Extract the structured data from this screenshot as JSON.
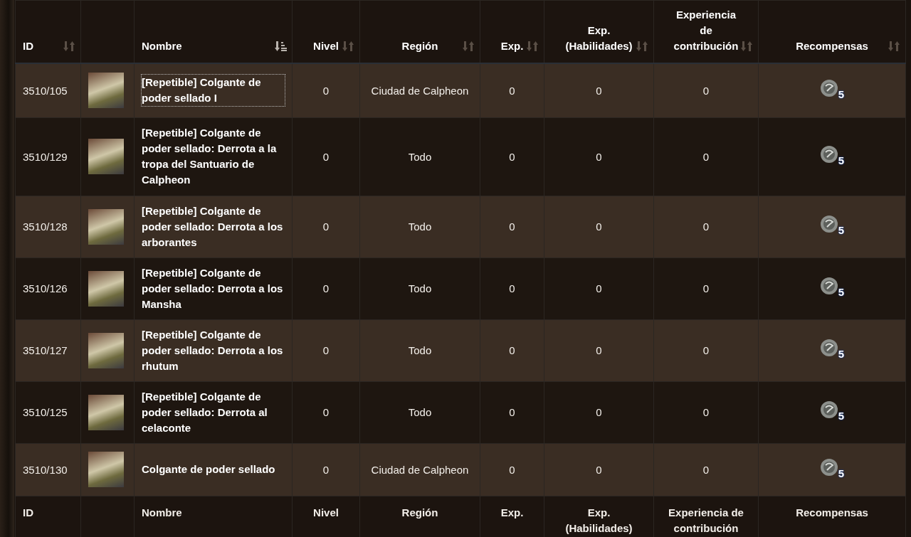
{
  "table": {
    "columns": [
      {
        "kind": "text",
        "label": "ID",
        "sortable": true,
        "sorted": false
      },
      {
        "kind": "image"
      },
      {
        "kind": "text",
        "label": "Nombre",
        "sortable": true,
        "sorted": true
      },
      {
        "kind": "text",
        "label": "Nivel",
        "sortable": true,
        "sorted": false
      },
      {
        "kind": "text",
        "label": "Región",
        "sortable": true,
        "sorted": false
      },
      {
        "kind": "text",
        "label": "Exp.",
        "sortable": true,
        "sorted": false
      },
      {
        "kind": "text",
        "label": "Exp. (Habilidades)",
        "sortable": true,
        "sorted": false
      },
      {
        "kind": "text",
        "label": "Experiencia de contribución",
        "sortable": true,
        "sorted": false
      },
      {
        "kind": "text",
        "label": "Recompensas",
        "sortable": true,
        "sorted": false
      }
    ],
    "rows": [
      {
        "id": "3510/105",
        "name": "[Repetible] Colgante de poder sellado I",
        "focused": true,
        "level": "0",
        "region": "Ciudad de Calpheon",
        "exp": "0",
        "exp_skills": "0",
        "contribution": "0",
        "reward_count": "5"
      },
      {
        "id": "3510/129",
        "name": "[Repetible] Colgante de poder sellado: Derrota a la tropa del Santuario de Calpheon",
        "focused": false,
        "level": "0",
        "region": "Todo",
        "exp": "0",
        "exp_skills": "0",
        "contribution": "0",
        "reward_count": "5"
      },
      {
        "id": "3510/128",
        "name": "[Repetible] Colgante de poder sellado: Derrota a los arborantes",
        "focused": false,
        "level": "0",
        "region": "Todo",
        "exp": "0",
        "exp_skills": "0",
        "contribution": "0",
        "reward_count": "5"
      },
      {
        "id": "3510/126",
        "name": "[Repetible] Colgante de poder sellado: Derrota a los Mansha",
        "focused": false,
        "level": "0",
        "region": "Todo",
        "exp": "0",
        "exp_skills": "0",
        "contribution": "0",
        "reward_count": "5"
      },
      {
        "id": "3510/127",
        "name": "[Repetible] Colgante de poder sellado: Derrota a los rhutum",
        "focused": false,
        "level": "0",
        "region": "Todo",
        "exp": "0",
        "exp_skills": "0",
        "contribution": "0",
        "reward_count": "5"
      },
      {
        "id": "3510/125",
        "name": "[Repetible] Colgante de poder sellado: Derrota al celaconte",
        "focused": false,
        "level": "0",
        "region": "Todo",
        "exp": "0",
        "exp_skills": "0",
        "contribution": "0",
        "reward_count": "5"
      },
      {
        "id": "3510/130",
        "name": "Colgante de poder sellado",
        "focused": false,
        "level": "0",
        "region": "Ciudad de Calpheon",
        "exp": "0",
        "exp_skills": "0",
        "contribution": "0",
        "reward_count": "5"
      }
    ],
    "footer": [
      "ID",
      "Nombre",
      "Nivel",
      "Región",
      "Exp.",
      "Exp. (Habilidades)",
      "Experiencia de contribución",
      "Recompensas"
    ]
  }
}
